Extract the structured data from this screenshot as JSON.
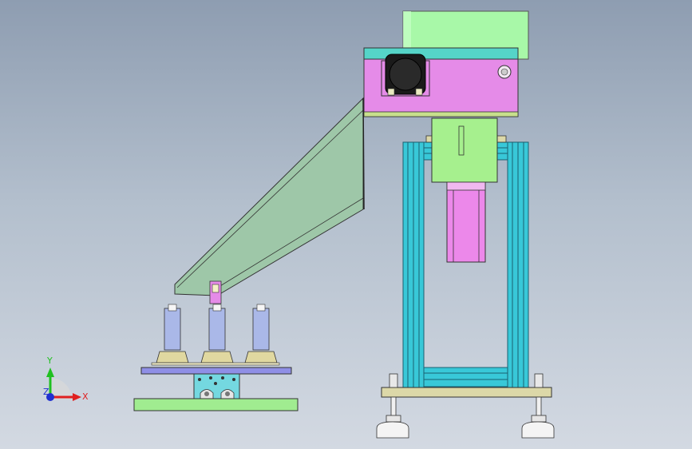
{
  "viewport": {
    "background_top": "#8e9db1",
    "background_bottom": "#d3d9e2"
  },
  "triad": {
    "x_label": "X",
    "y_label": "Y",
    "z_label": "Z",
    "x_color": "#e02020",
    "y_color": "#20c020",
    "z_color": "#2030d0"
  },
  "colors": {
    "bowl": "#a8f8a8",
    "drive_box": "#e58be8",
    "drive_top": "#55d4c8",
    "chute": "#9ec7a8",
    "frame_profile": "#38c8d8",
    "motor": "#ec88ea",
    "motor_mount": "#a6f08e",
    "base_plate": "#dcd8a8",
    "feet": "#f0f0f0",
    "nozzle_cyl": "#aab8e8",
    "fixture_plate": "#8f8fe6",
    "lower_plate": "#a0ec90",
    "block": "#74d8e0",
    "pads": "#e0d8a0"
  }
}
